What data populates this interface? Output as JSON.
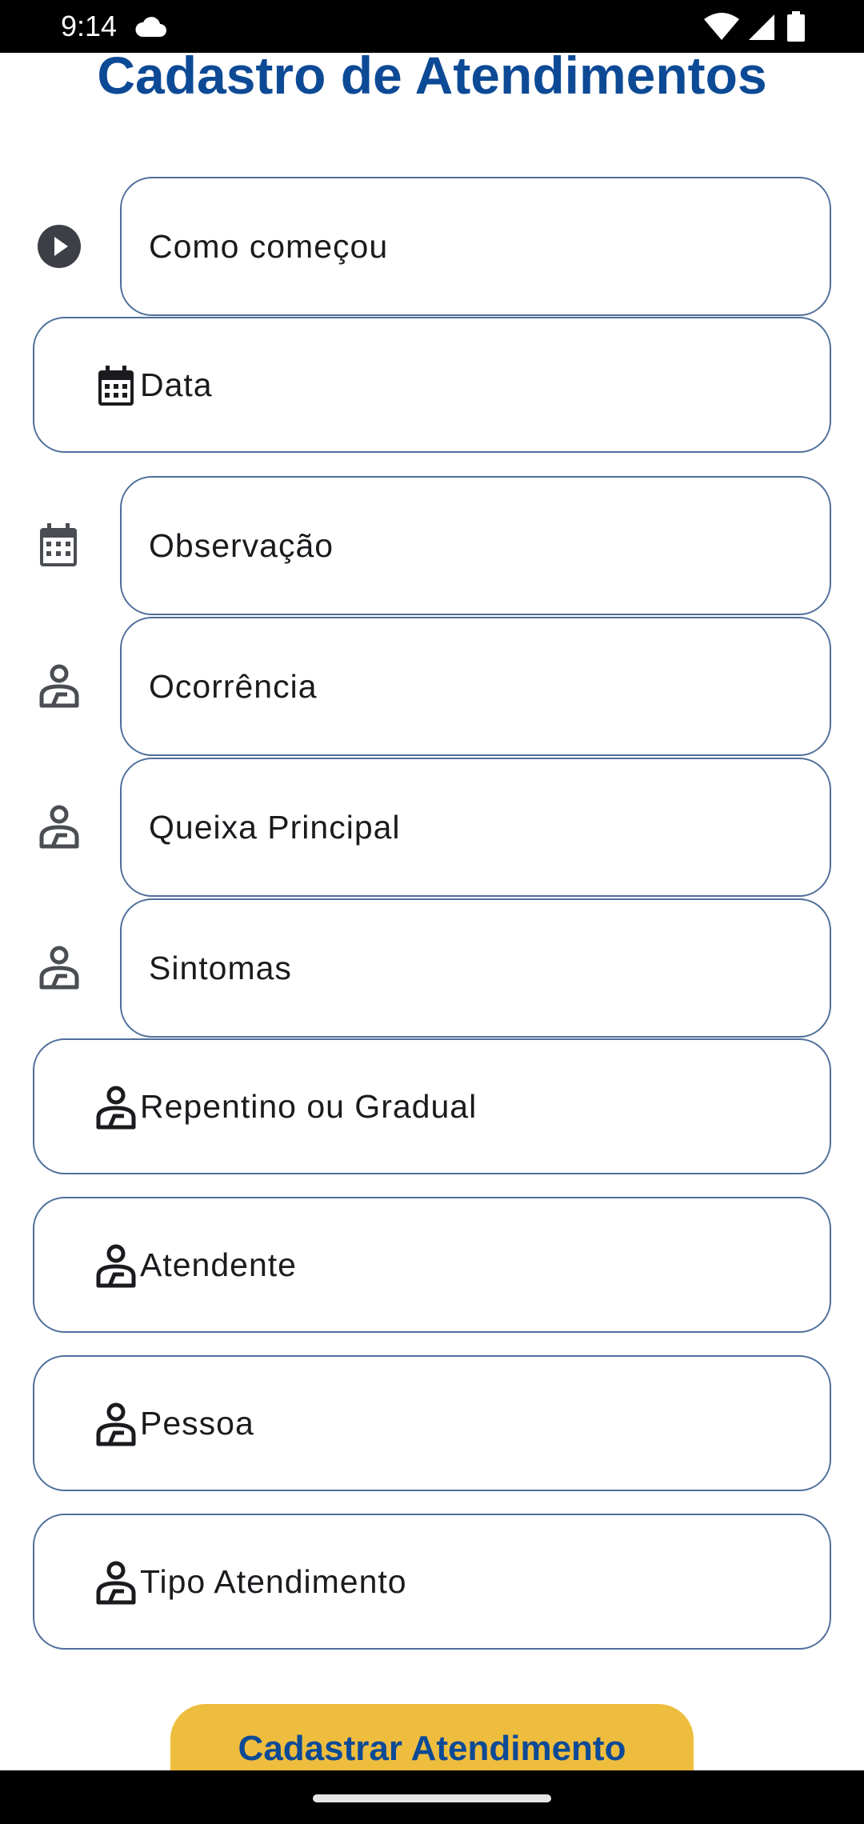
{
  "status_bar": {
    "time": "9:14",
    "icons": [
      "cloud-icon",
      "wifi-icon",
      "cellular-icon",
      "battery-icon"
    ]
  },
  "page": {
    "title": "Cadastro de Atendimentos"
  },
  "form": {
    "fields": [
      {
        "label": "Como começou",
        "icon": "play-circle-icon"
      },
      {
        "label": "Data",
        "icon": "calendar-icon"
      },
      {
        "label": "Observação",
        "icon": "calendar-icon"
      },
      {
        "label": "Ocorrência",
        "icon": "person-medical-icon"
      },
      {
        "label": "Queixa Principal",
        "icon": "person-medical-icon"
      },
      {
        "label": "Sintomas",
        "icon": "person-medical-icon"
      },
      {
        "label": "Repentino ou Gradual",
        "icon": "person-medical-icon"
      },
      {
        "label": "Atendente",
        "icon": "person-medical-icon"
      },
      {
        "label": "Pessoa",
        "icon": "person-medical-icon"
      },
      {
        "label": "Tipo Atendimento",
        "icon": "person-medical-icon"
      }
    ],
    "submit_label": "Cadastrar Atendimento"
  },
  "colors": {
    "title": "#0d4a96",
    "button": "#efbd3e",
    "border": "#4f6f9a"
  }
}
